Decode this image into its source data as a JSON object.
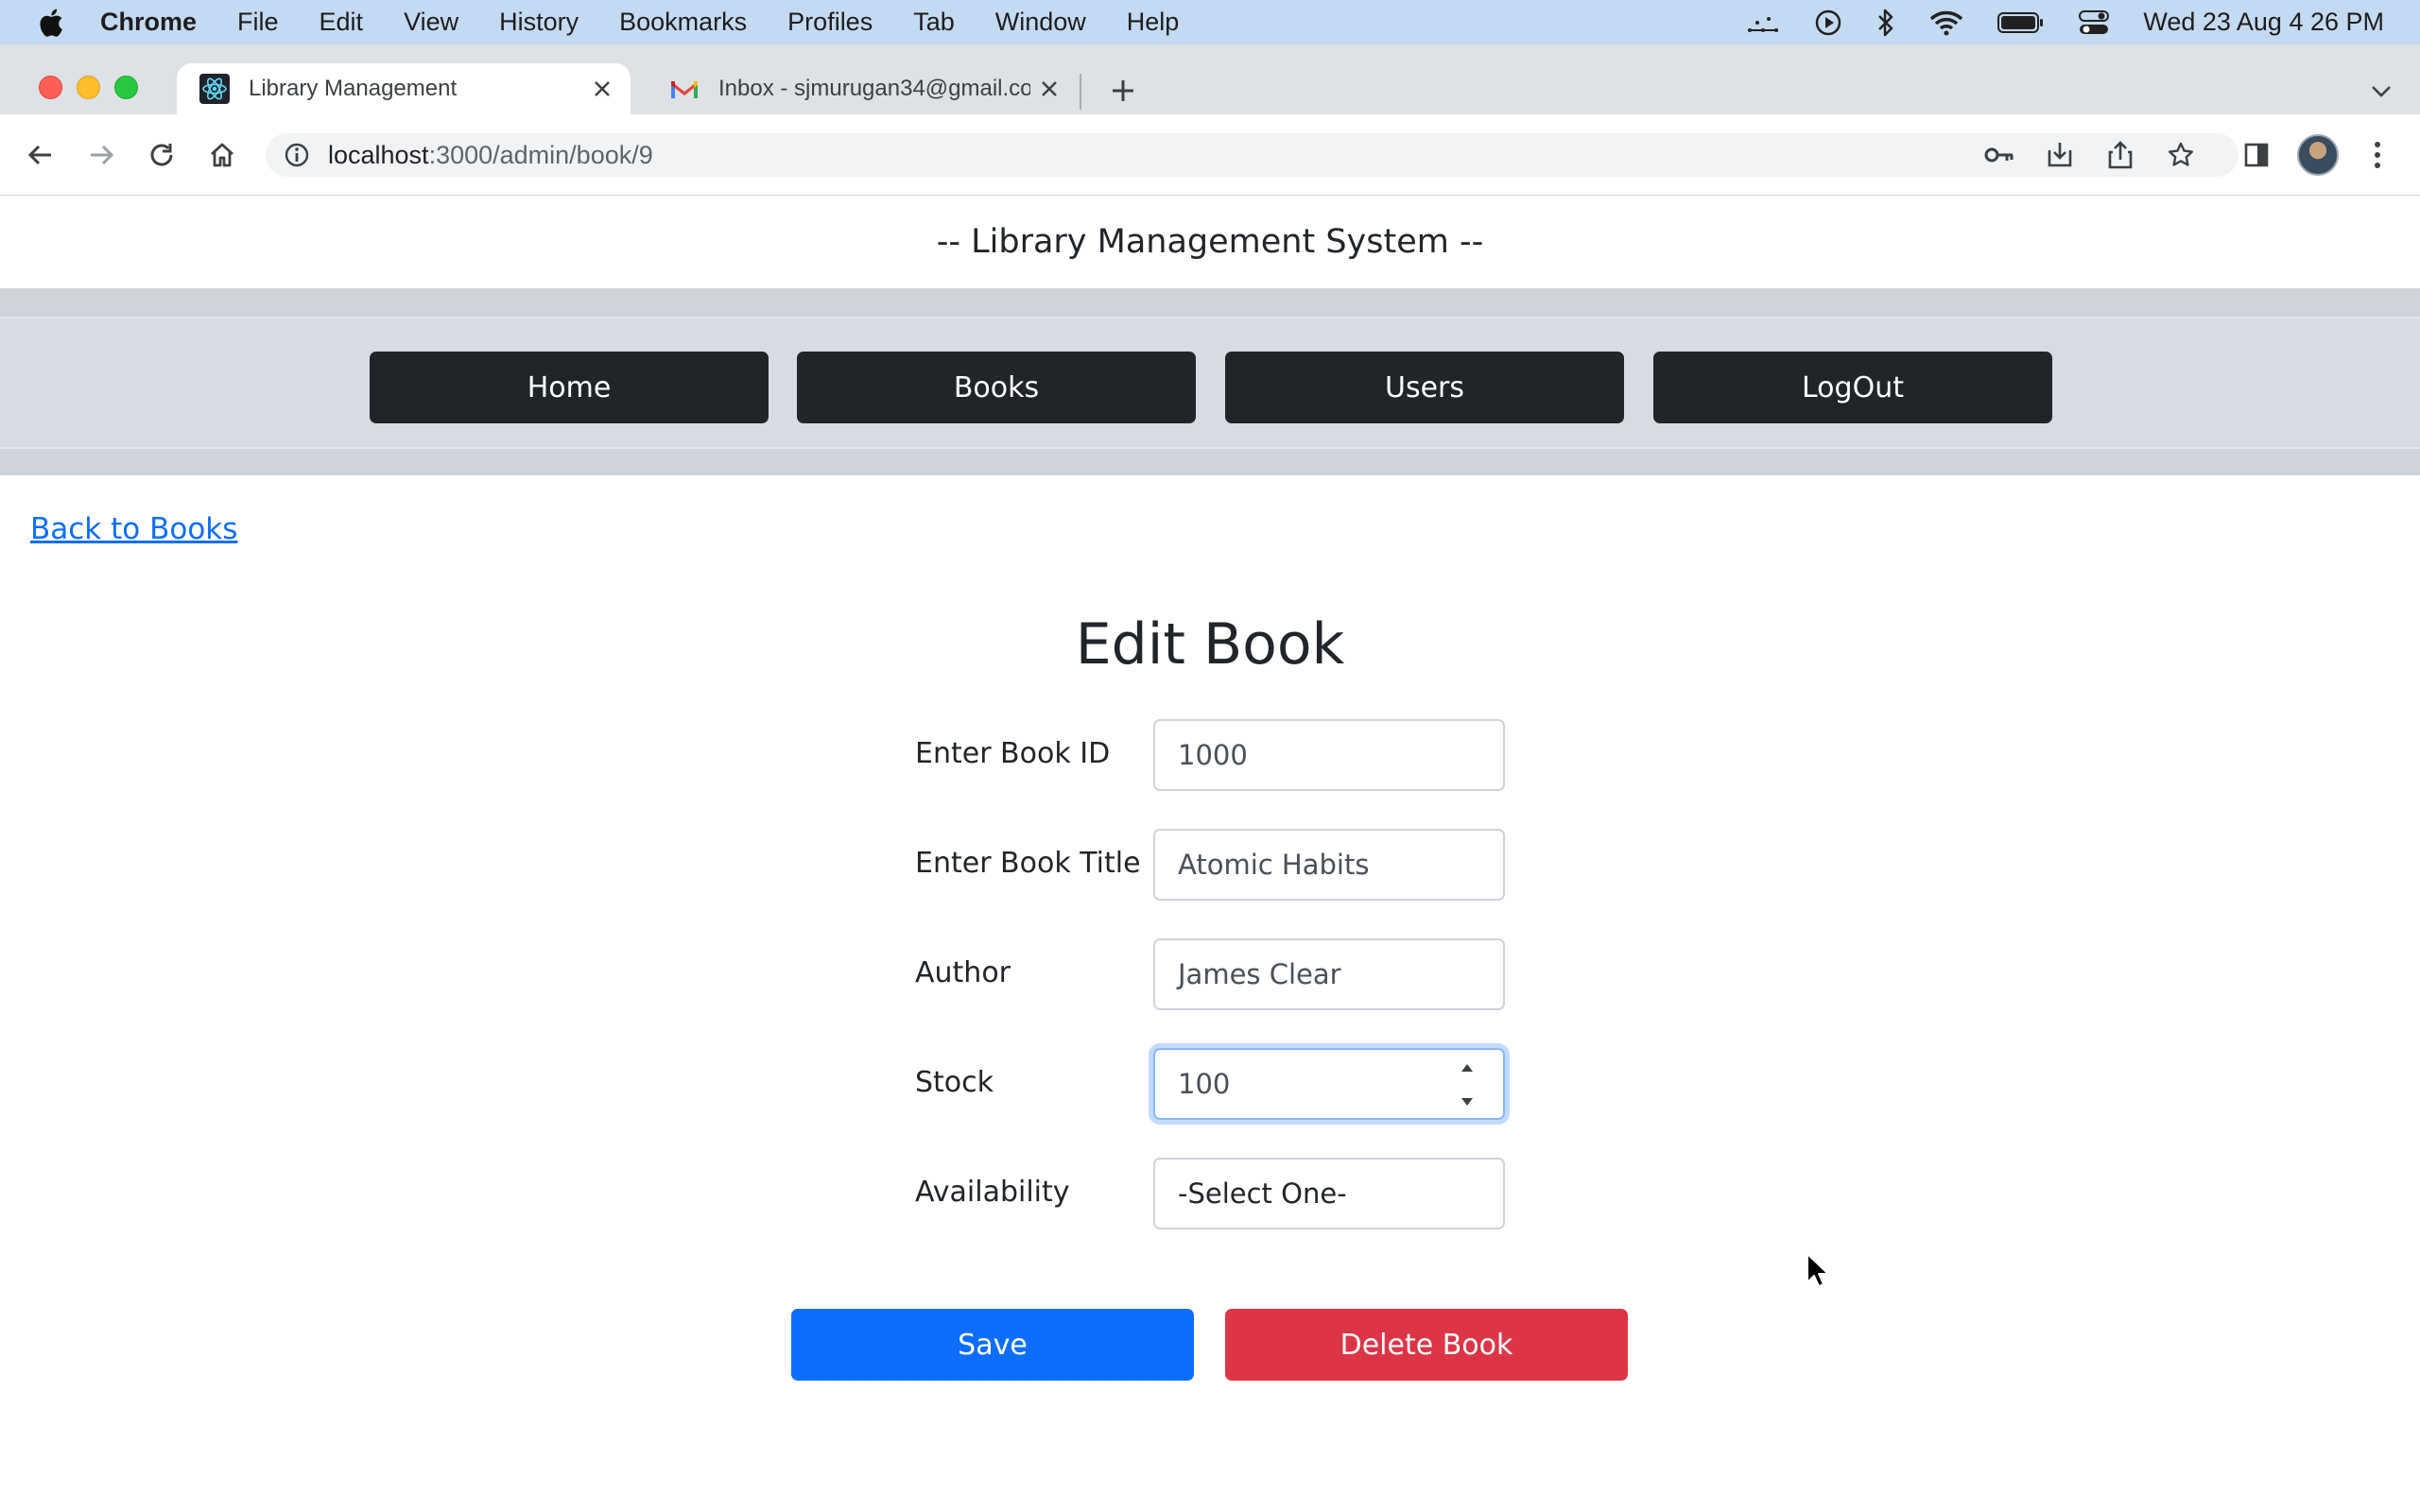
{
  "menubar": {
    "app_name": "Chrome",
    "items": [
      "File",
      "Edit",
      "View",
      "History",
      "Bookmarks",
      "Profiles",
      "Tab",
      "Window",
      "Help"
    ],
    "clock": "Wed 23 Aug  4 26 PM"
  },
  "browser": {
    "tabs": [
      {
        "title": "Library Management",
        "favicon": "react-icon"
      },
      {
        "title": "Inbox - sjmurugan34@gmail.com",
        "favicon": "gmail-icon"
      }
    ],
    "url_host": "localhost",
    "url_path": ":3000/admin/book/9"
  },
  "site": {
    "header": "-- Library Management System --",
    "nav": [
      "Home",
      "Books",
      "Users",
      "LogOut"
    ],
    "back_link": "Back to Books"
  },
  "form": {
    "title": "Edit Book",
    "fields": [
      {
        "label": "Enter Book ID",
        "value": "1000"
      },
      {
        "label": "Enter Book Title",
        "value": "Atomic Habits"
      },
      {
        "label": "Author",
        "value": "James Clear"
      },
      {
        "label": "Stock",
        "value": "100"
      },
      {
        "label": "Availability",
        "value": "-Select One-"
      }
    ],
    "save_label": "Save",
    "delete_label": "Delete Book"
  },
  "colors": {
    "primary": "#0d6efd",
    "danger": "#dc3545",
    "dark": "#212529",
    "nav_band": "#ced4da"
  }
}
